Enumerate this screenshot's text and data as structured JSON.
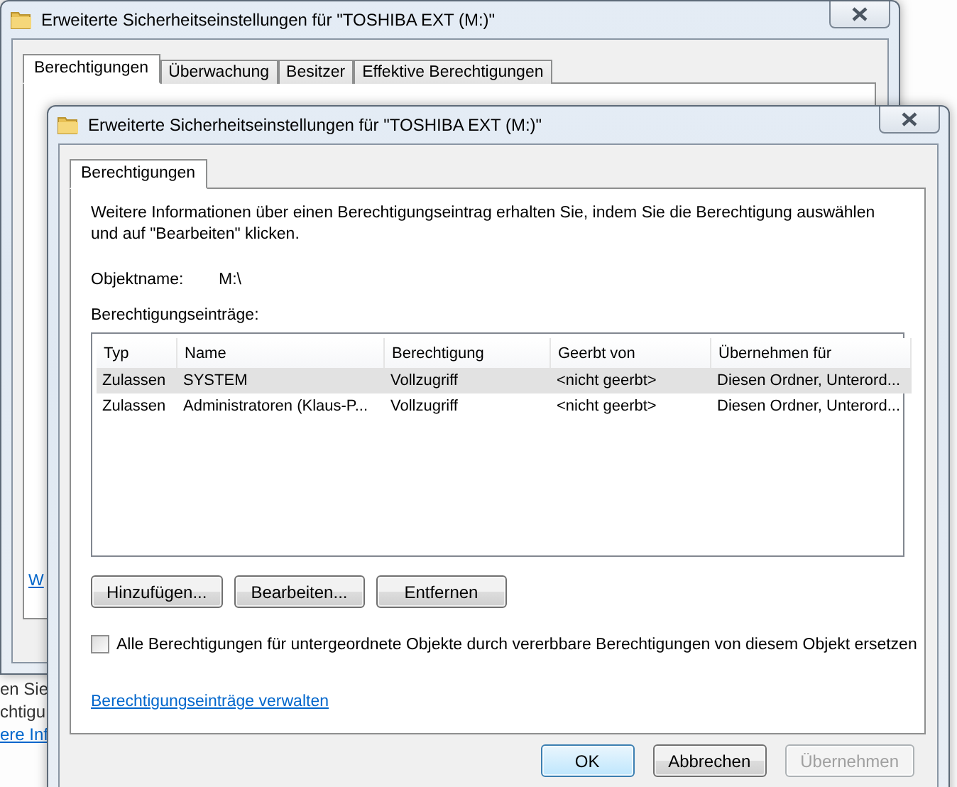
{
  "background_window": {
    "title": "Erweiterte Sicherheitseinstellungen für \"TOSHIBA EXT (M:)\"",
    "tabs": [
      {
        "label": "Berechtigungen",
        "selected": true
      },
      {
        "label": "Überwachung",
        "selected": false
      },
      {
        "label": "Besitzer",
        "selected": false
      },
      {
        "label": "Effektive Berechtigungen",
        "selected": false
      }
    ],
    "link": "W"
  },
  "left_fragments": [
    {
      "text": "en Sie",
      "kind": "text"
    },
    {
      "text": "chtigu",
      "kind": "text"
    },
    {
      "text": "ere Inf",
      "kind": "link"
    }
  ],
  "window": {
    "title": "Erweiterte Sicherheitseinstellungen für \"TOSHIBA EXT (M:)\"",
    "tabs": [
      {
        "label": "Berechtigungen",
        "selected": true
      }
    ],
    "info": "Weitere Informationen über einen Berechtigungseintrag erhalten Sie, indem Sie die Berechtigung auswählen und auf \"Bearbeiten\" klicken.",
    "object_label": "Objektname:",
    "object_value": "M:\\",
    "entries_label": "Berechtigungseinträge:",
    "table": {
      "columns": [
        "Typ",
        "Name",
        "Berechtigung",
        "Geerbt von",
        "Übernehmen für"
      ],
      "rows": [
        {
          "cells": [
            "Zulassen",
            "SYSTEM",
            "Vollzugriff",
            "<nicht geerbt>",
            "Diesen Ordner, Unterord..."
          ],
          "selected": true
        },
        {
          "cells": [
            "Zulassen",
            "Administratoren (Klaus-P...",
            "Vollzugriff",
            "<nicht geerbt>",
            "Diesen Ordner, Unterord..."
          ],
          "selected": false
        }
      ]
    },
    "buttons": [
      "Hinzufügen...",
      "Bearbeiten...",
      "Entfernen"
    ],
    "checkbox": {
      "label": "Alle Berechtigungen für untergeordnete Objekte durch vererbbare Berechtigungen von diesem Objekt ersetzen",
      "checked": false
    },
    "link": "Berechtigungseinträge verwalten",
    "dialog_buttons": [
      {
        "label": "OK",
        "kind": "default",
        "disabled": false
      },
      {
        "label": "Abbrechen",
        "kind": "normal",
        "disabled": false
      },
      {
        "label": "Übernehmen",
        "kind": "normal",
        "disabled": true
      }
    ]
  }
}
